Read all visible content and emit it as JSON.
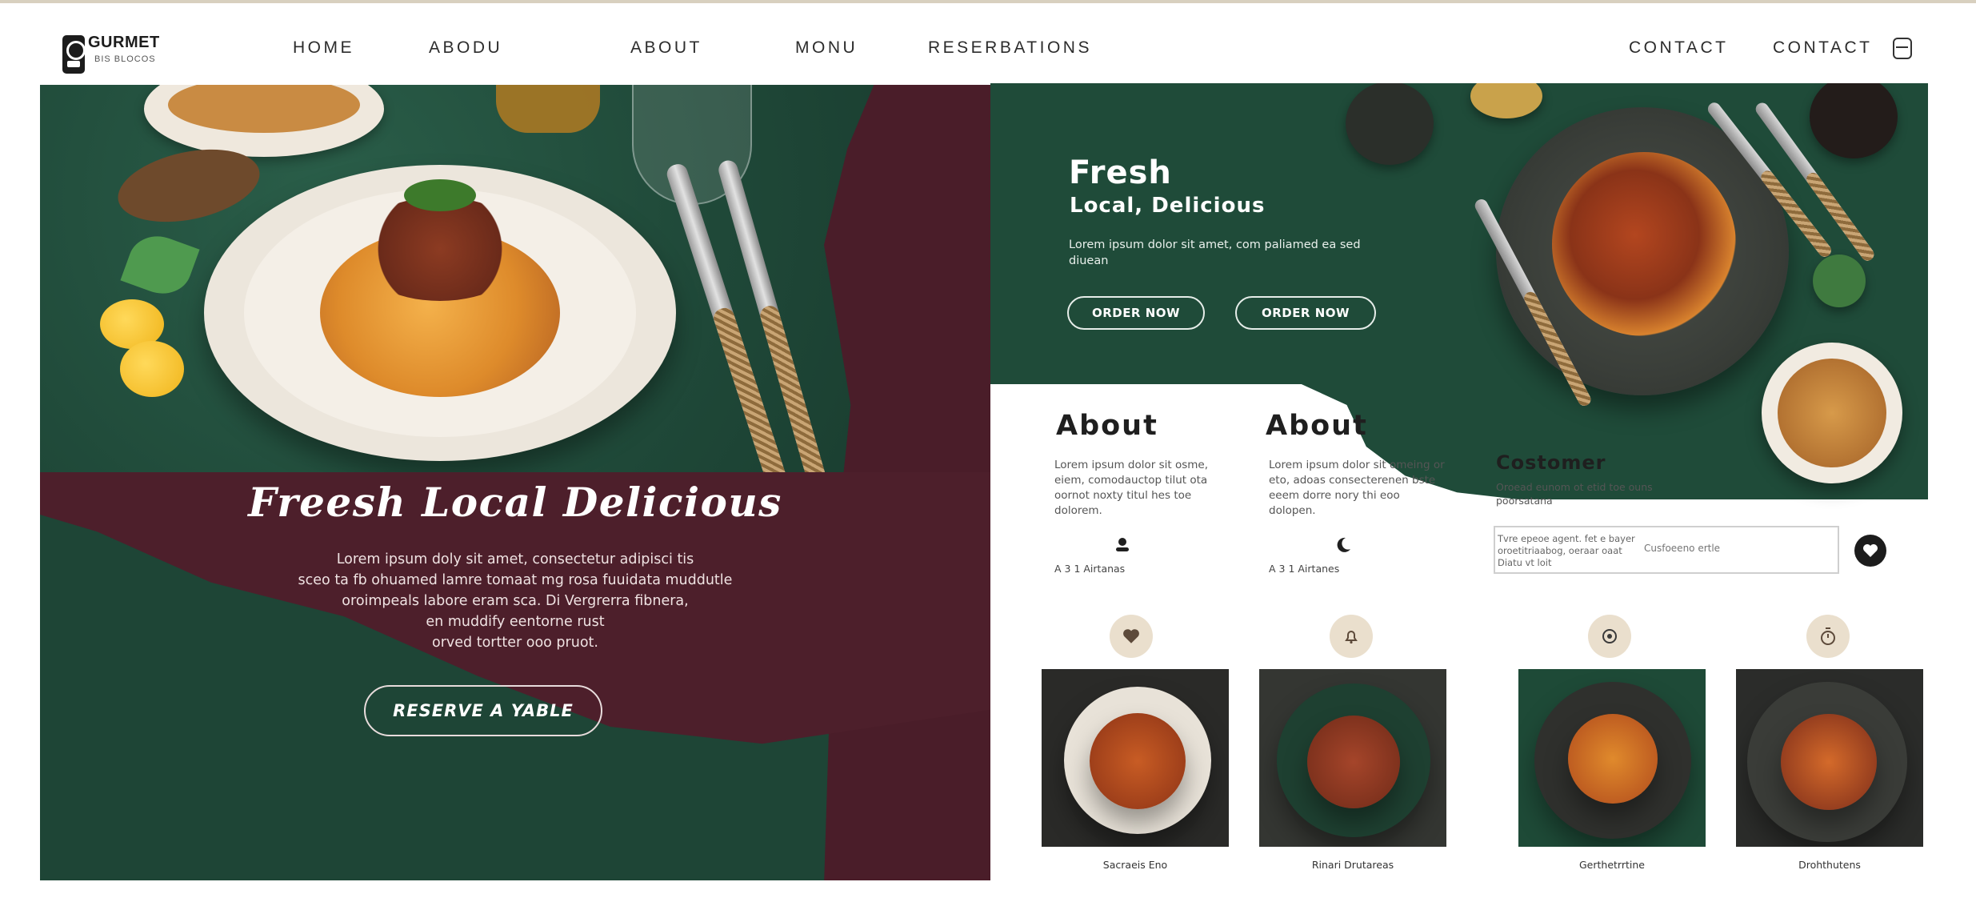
{
  "brand": {
    "name": "GURMET",
    "tagline": "BIS BLOCOS"
  },
  "nav": {
    "items": [
      "HOME",
      "ABODU",
      "ABOUT",
      "MONU",
      "RESERBATIONS"
    ],
    "right": [
      "CONTACT",
      "CONTACT"
    ],
    "cart_icon": "bag-icon"
  },
  "hero": {
    "title": "Freesh Local Delicious",
    "body": [
      "Lorem ipsum doly sit amet, consectetur adipisci tis",
      "sceo ta fb ohuamed lamre tomaat mg rosa fuuidata muddutle",
      "oroimpeals labore eram sca. Di Vergrerra fibnera,",
      "en muddify eentorne rust",
      "orved tortter ooo pruot."
    ],
    "button": "RESERVE A YABLE"
  },
  "feature": {
    "title": "Fresh",
    "subtitle": "Local, Delicious",
    "body": "Lorem ipsum dolor sit amet, com paliamed ea sed diuean",
    "buttons": [
      "ORDER NOW",
      "ORDER NOW"
    ]
  },
  "about": [
    {
      "title": "About",
      "text": "Lorem ipsum dolor sit osme, eiem, comodauctop tilut ota oornot noxty titul hes toe dolorem.",
      "meta": "A 3 1   Airtanas",
      "icon": "person-icon"
    },
    {
      "title": "About",
      "text": "Lorem ipsum dolor sit omeing or eto, adoas consecterenen bste eeem dorre nory thi eoo dolopen.",
      "meta": "A 3 1   Airtanes",
      "icon": "moon-icon"
    }
  ],
  "customer": {
    "title": "Costomer",
    "text": "Oroead eunom ot etid toe ouns poorsatana",
    "note": "Tvre epeoe agent. fet e bayer oroetitriaabog, oeraar oaat Diatu vt loit",
    "input_placeholder": "Cusfoeeno ertle"
  },
  "gallery": [
    {
      "caption": "Sacraeis Eno",
      "badge_icon": "heart-icon"
    },
    {
      "caption": "Rinari Drutareas",
      "badge_icon": "bell-icon"
    },
    {
      "caption": "Gerthetrrtine",
      "badge_icon": "target-icon"
    },
    {
      "caption": "Drohthutens",
      "badge_icon": "clock-icon"
    }
  ],
  "colors": {
    "accent_green": "#1f4b39",
    "accent_wine": "#4d1f2b",
    "badge": "#eadfcd"
  }
}
